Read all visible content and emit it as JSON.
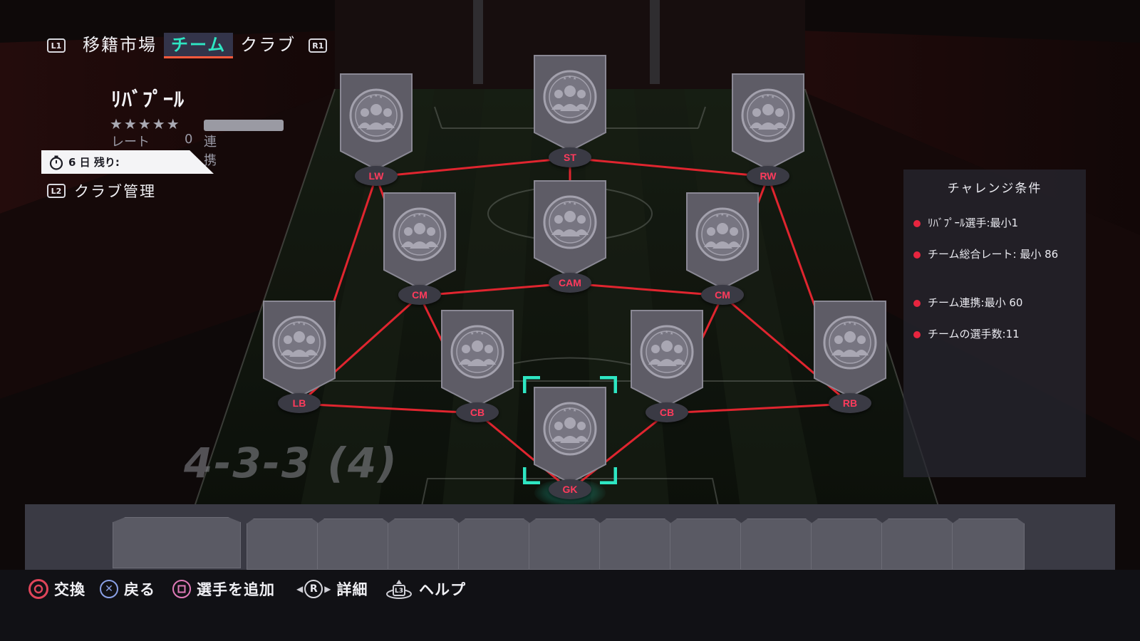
{
  "nav": {
    "left_shoulder": "L1",
    "right_shoulder": "R1",
    "tabs": [
      {
        "label": "移籍市場"
      },
      {
        "label": "チーム"
      },
      {
        "label": "クラブ"
      }
    ]
  },
  "club": {
    "name": "ﾘﾊﾞﾌﾟｰﾙ",
    "stars": "★★★★★",
    "rate_label": "レート",
    "rate_value": "0",
    "chemistry_label": "連携",
    "timer_text": "6 日 残り:",
    "management_button": "L2",
    "management_label": "クラブ管理"
  },
  "formation": "4-3-3 (4)",
  "positions": [
    {
      "label": "LW"
    },
    {
      "label": "ST"
    },
    {
      "label": "RW"
    },
    {
      "label": "CM"
    },
    {
      "label": "CAM"
    },
    {
      "label": "CM"
    },
    {
      "label": "LB"
    },
    {
      "label": "CB"
    },
    {
      "label": "CB"
    },
    {
      "label": "RB"
    },
    {
      "label": "GK"
    }
  ],
  "challenge": {
    "title": "チャレンジ条件",
    "requirements": [
      "ﾘﾊﾞﾌﾟｰﾙ選手:最小1",
      "チーム総合レート: 最小 86",
      "チーム連携:最小 60",
      "チームの選手数:11"
    ]
  },
  "bottom_hints": [
    {
      "button": "○",
      "label": "交換"
    },
    {
      "button": "✕",
      "label": "戻る"
    },
    {
      "button": "□",
      "label": "選手を追加"
    },
    {
      "button": "R",
      "label": "詳細"
    },
    {
      "button": "L3",
      "label": "ヘルプ"
    }
  ],
  "colors": {
    "accent_teal": "#2ee6c3",
    "link_red": "#e0252f",
    "position_red": "#ff3b5c",
    "requirement_dot": "#e8253f"
  }
}
